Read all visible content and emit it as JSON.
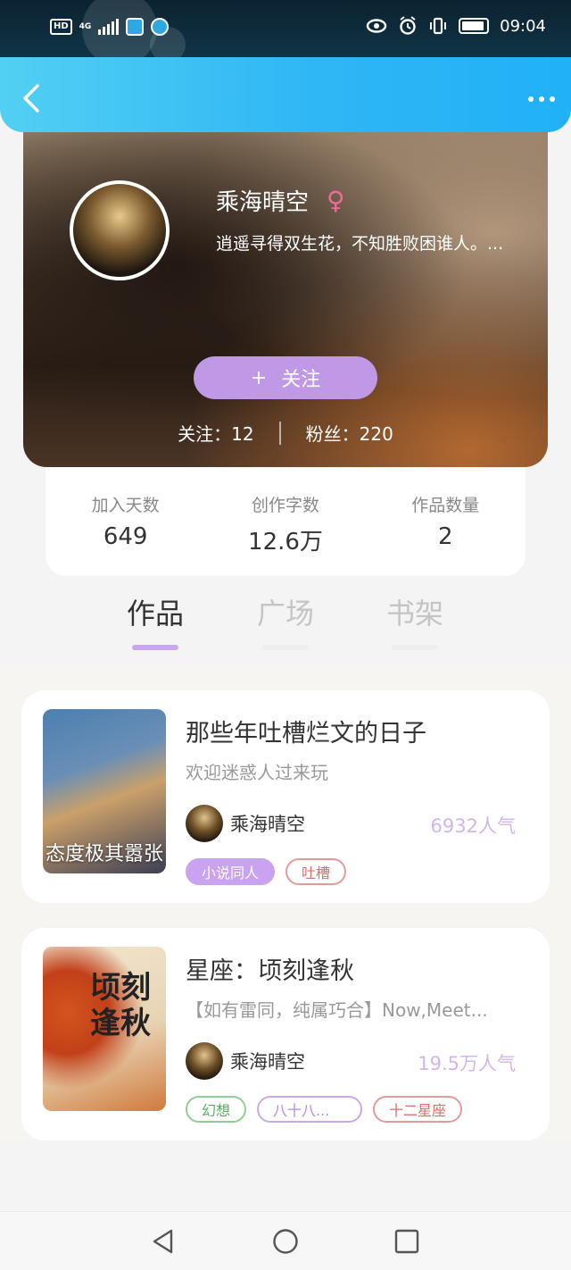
{
  "statusbar": {
    "network": "4G",
    "hd": "HD",
    "time": "09:04"
  },
  "header": {
    "back_icon": "chevron-left-icon",
    "more_icon": "more-dots-icon"
  },
  "profile": {
    "name": "乘海晴空",
    "gender_symbol": "♀",
    "bio": "逍遥寻得双生花，不知胜败困谁人。...",
    "follow_plus": "+",
    "follow_label": "关注",
    "following_label": "关注：12",
    "fans_label": "粉丝：220"
  },
  "stats": [
    {
      "label": "加入天数",
      "value": "649"
    },
    {
      "label": "创作字数",
      "value": "12.6万"
    },
    {
      "label": "作品数量",
      "value": "2"
    }
  ],
  "tabs": [
    {
      "label": "作品",
      "active": true
    },
    {
      "label": "广场",
      "active": false
    },
    {
      "label": "书架",
      "active": false
    }
  ],
  "books": [
    {
      "title": "那些年吐槽烂文的日子",
      "desc": "欢迎迷惑人过来玩",
      "cover_text": "态度极其嚣张",
      "author": "乘海晴空",
      "popularity": "6932人气",
      "tags": [
        "小说同人",
        "吐槽"
      ]
    },
    {
      "title": "星座：顷刻逢秋",
      "desc": "【如有雷同，纯属巧合】Now,Meet...",
      "cover_title": "顷刻逢秋",
      "author": "乘海晴空",
      "popularity": "19.5万人气",
      "tags": [
        "幻想",
        "八十八...",
        "十二星座"
      ]
    }
  ],
  "navbar": {
    "back_icon": "triangle-back-icon",
    "home_icon": "circle-home-icon",
    "recent_icon": "square-recents-icon"
  },
  "colors": {
    "header_blue": "#2fb6f5",
    "accent_purple": "#c099e6",
    "gender_pink": "#f06b9a"
  }
}
